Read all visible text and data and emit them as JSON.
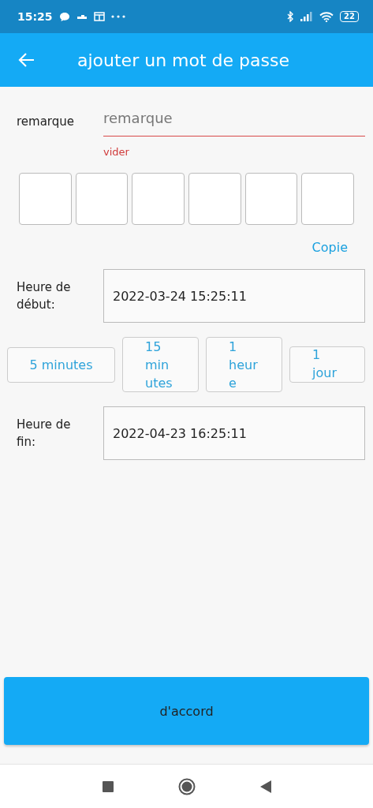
{
  "status_bar": {
    "time": "15:25",
    "battery": "22"
  },
  "app_bar": {
    "title": "ajouter un mot de passe"
  },
  "remark": {
    "label": "remarque",
    "placeholder": "remarque",
    "error": "vider"
  },
  "code_boxes": [
    {
      "kind": "digit"
    },
    {
      "kind": "digit"
    },
    {
      "kind": "digit"
    },
    {
      "kind": "digit"
    },
    {
      "kind": "digit"
    },
    {
      "kind": "digit"
    }
  ],
  "copy_link": "Copie",
  "start": {
    "label_lines": [
      "Heure de",
      "début:"
    ],
    "value": "2022-03-24 15:25:11"
  },
  "durations": [
    {
      "lines": [
        "5 minutes"
      ]
    },
    {
      "lines": [
        "15",
        "min",
        "utes"
      ]
    },
    {
      "lines": [
        "1",
        "heur",
        "e"
      ]
    },
    {
      "lines": [
        "1",
        "jour"
      ]
    }
  ],
  "end": {
    "label_lines": [
      "Heure de",
      "fin:"
    ],
    "value": "2022-04-23 16:25:11"
  },
  "confirm_button": "d'accord"
}
